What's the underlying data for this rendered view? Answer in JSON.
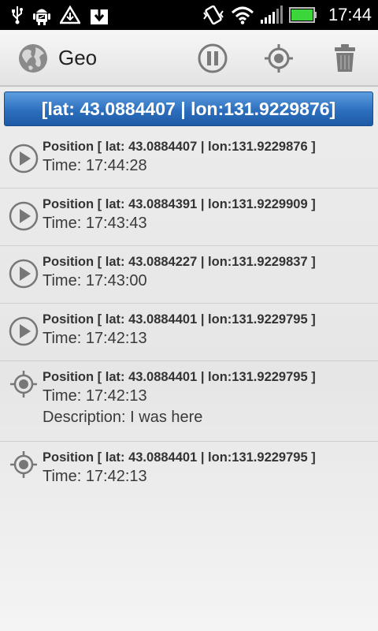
{
  "status_bar": {
    "time": "17:44",
    "left_icons": [
      "usb-icon",
      "android-debug-icon",
      "warning-icon",
      "download-icon"
    ],
    "right_icons": [
      "vibrate-icon",
      "wifi-icon",
      "signal-icon",
      "battery-icon"
    ]
  },
  "action_bar": {
    "title": "Geo",
    "actions": [
      "pause-icon",
      "locate-icon",
      "trash-icon"
    ]
  },
  "current_position": "[lat: 43.0884407 | lon:131.9229876]",
  "colors": {
    "banner_top": "#5d9ddf",
    "banner_bottom": "#1e5aa6",
    "icon_gray": "#777777"
  },
  "entries": [
    {
      "icon": "play-icon",
      "position": "Position [ lat: 43.0884407 | lon:131.9229876 ]",
      "time": "Time: 17:44:28"
    },
    {
      "icon": "play-icon",
      "position": "Position [ lat: 43.0884391 | lon:131.9229909 ]",
      "time": "Time: 17:43:43"
    },
    {
      "icon": "play-icon",
      "position": "Position [ lat: 43.0884227 | lon:131.9229837 ]",
      "time": "Time: 17:43:00"
    },
    {
      "icon": "play-icon",
      "position": "Position [ lat: 43.0884401 | lon:131.9229795 ]",
      "time": "Time: 17:42:13"
    },
    {
      "icon": "target-icon",
      "position": "Position [ lat: 43.0884401 | lon:131.9229795 ]",
      "time": "Time: 17:42:13",
      "description": "Description: I was here"
    },
    {
      "icon": "target-icon",
      "position": "Position [ lat: 43.0884401 | lon:131.9229795 ]",
      "time": "Time: 17:42:13"
    }
  ]
}
